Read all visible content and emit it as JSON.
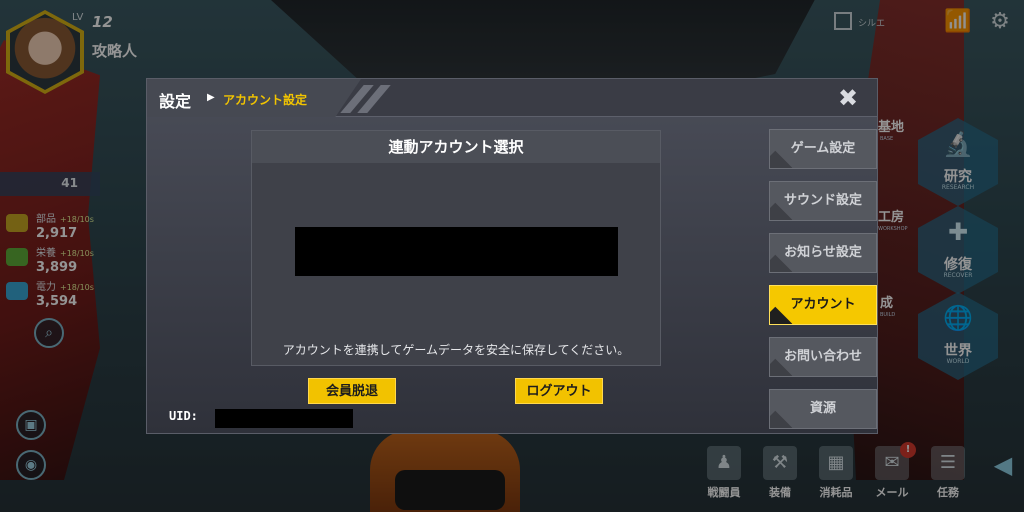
{
  "player": {
    "lv_label": "LV",
    "level": "12",
    "name": "攻略人"
  },
  "resources": {
    "bar_value": "41",
    "items": [
      {
        "name": "部品",
        "rate": "+18/10s",
        "amount": "2,917"
      },
      {
        "name": "栄養",
        "rate": "+18/10s",
        "amount": "3,899"
      },
      {
        "name": "電力",
        "rate": "+18/10s",
        "amount": "3,594"
      }
    ]
  },
  "top_right": {
    "checkbox_label": "シルエ"
  },
  "menu": {
    "base": {
      "label": "基地",
      "sub": "BASE"
    },
    "research": {
      "label": "研究",
      "sub": "RESEARCH"
    },
    "workshop": {
      "label": "工房",
      "sub": "WORKSHOP"
    },
    "recover": {
      "label": "修復",
      "sub": "RECOVER"
    },
    "build": {
      "label": "成",
      "sub": "BUILD"
    },
    "world": {
      "label": "世界",
      "sub": "WORLD"
    }
  },
  "bottom_nav": [
    {
      "label": "戦闘員",
      "icon": "soldier-icon"
    },
    {
      "label": "装備",
      "icon": "equipment-icon"
    },
    {
      "label": "消耗品",
      "icon": "consumable-icon"
    },
    {
      "label": "メール",
      "icon": "mail-icon"
    },
    {
      "label": "任務",
      "icon": "mission-icon"
    }
  ],
  "mail_badge": "!",
  "dialog": {
    "title": "設定",
    "breadcrumb": "アカウント設定",
    "panel_title": "連動アカウント選択",
    "panel_note": "アカウントを連携してゲームデータを安全に保存してください。",
    "withdraw_label": "会員脱退",
    "logout_label": "ログアウト",
    "uid_label": "UID:",
    "side_menu": [
      {
        "label": "ゲーム設定",
        "active": false
      },
      {
        "label": "サウンド設定",
        "active": false
      },
      {
        "label": "お知らせ設定",
        "active": false
      },
      {
        "label": "アカウント",
        "active": true
      },
      {
        "label": "お問い合わせ",
        "active": false
      },
      {
        "label": "資源",
        "active": false
      }
    ]
  },
  "colors": {
    "accent": "#f2c200",
    "dialog_bg": "#3a3c45",
    "side_button": "#55585f"
  }
}
